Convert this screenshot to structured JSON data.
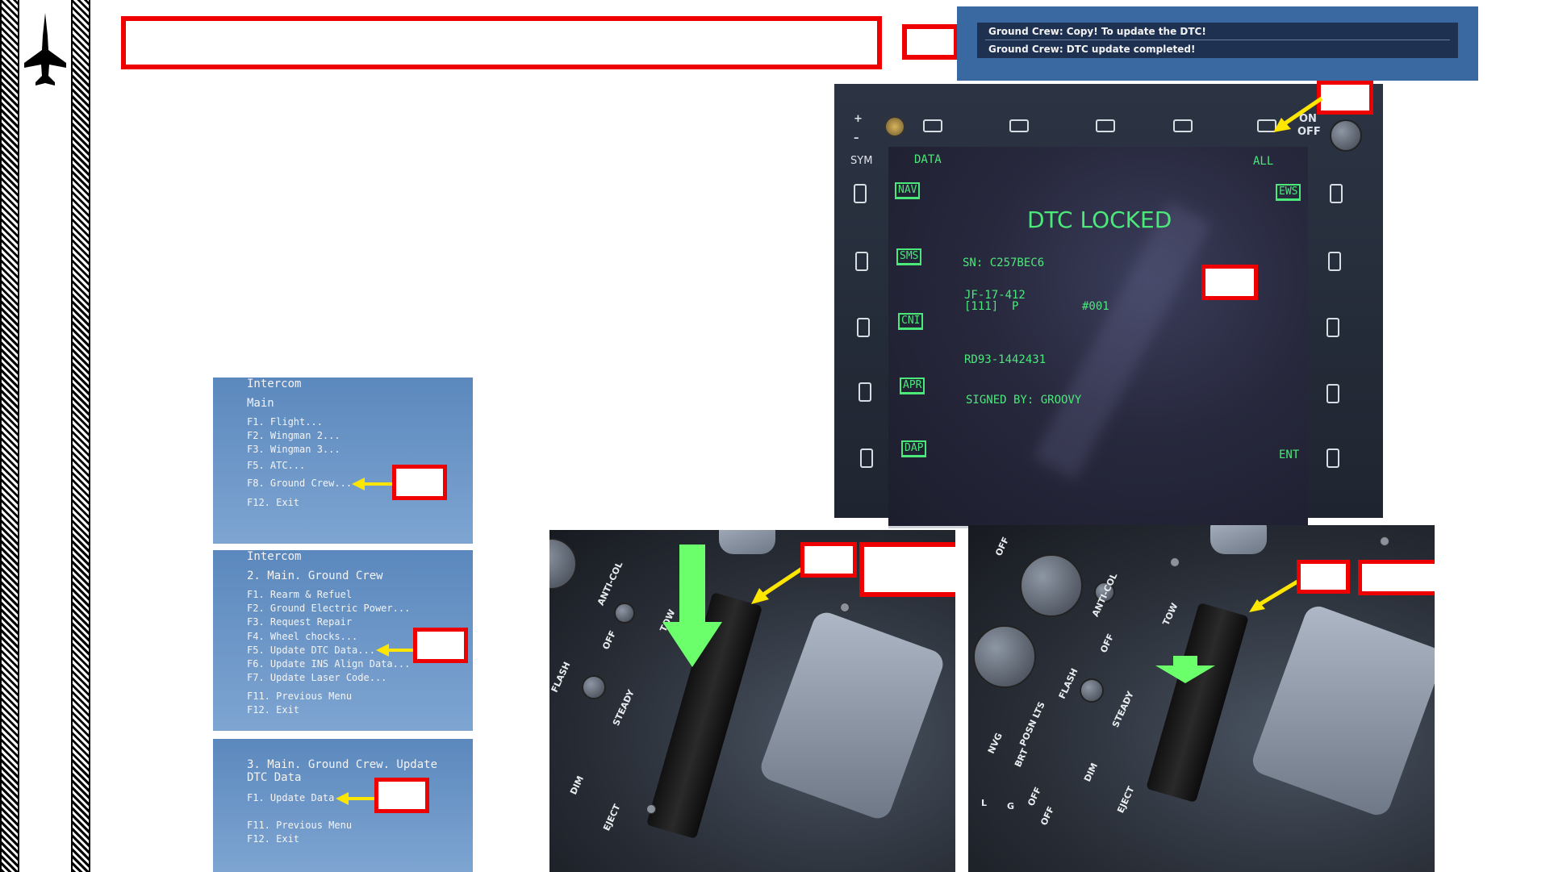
{
  "message_bar": {
    "line1": "Ground Crew: Copy! To update the DTC!",
    "line2": "Ground Crew: DTC update completed!"
  },
  "mfd": {
    "labels": {
      "sym": "SYM",
      "data": "DATA",
      "all": "ALL",
      "on": "ON",
      "off": "OFF",
      "ent": "ENT",
      "plus": "+",
      "minus": "–"
    },
    "left_osb": [
      "NAV",
      "SMS",
      "CNI",
      "APR",
      "DAP"
    ],
    "right_osb": [
      "EWS"
    ],
    "screen": {
      "title": "DTC LOCKED",
      "serial": "SN: C257BEC6",
      "aircraft": "JF-17-412",
      "config": "[111]  P",
      "number": "#001",
      "engine": "RD93-1442431",
      "signed": "SIGNED BY: GROOVY"
    }
  },
  "menu1": {
    "header": "Intercom",
    "title": "Main",
    "items": [
      "F1. Flight...",
      "F2. Wingman 2...",
      "F3. Wingman 3...",
      "F5. ATC...",
      "F8. Ground Crew...",
      "F12. Exit"
    ]
  },
  "menu2": {
    "header": "Intercom",
    "title": "2. Main. Ground Crew",
    "items": [
      "F1. Rearm & Refuel",
      "F2. Ground Electric Power...",
      "F3. Request Repair",
      "F4. Wheel chocks...",
      "F5. Update DTC Data...",
      "F6. Update INS Align Data...",
      "F7. Update Laser Code...",
      "F11. Previous Menu",
      "F12. Exit"
    ]
  },
  "menu3": {
    "title_line1": "3. Main. Ground Crew. Update",
    "title_line2": "DTC Data",
    "items": [
      "F1. Update Data",
      "F11. Previous Menu",
      "F12. Exit"
    ]
  },
  "panel_labels": {
    "left": [
      "ANTI-COL",
      "OFF",
      "TOW",
      "FLASH",
      "STEADY",
      "DIM",
      "EJECT"
    ],
    "right": [
      "OFF",
      "ANTI-COL",
      "OFF",
      "TOW",
      "FLASH",
      "STEADY",
      "POSN LTS",
      "BRT",
      "NVG",
      "OFF",
      "DIM",
      "EJECT",
      "L",
      "G",
      "OFF"
    ]
  },
  "colors": {
    "annotation_red": "#e00000",
    "arrow_yellow": "#ffe600",
    "arrow_green": "#6cff6c",
    "mfd_text_green": "#4be87a"
  }
}
